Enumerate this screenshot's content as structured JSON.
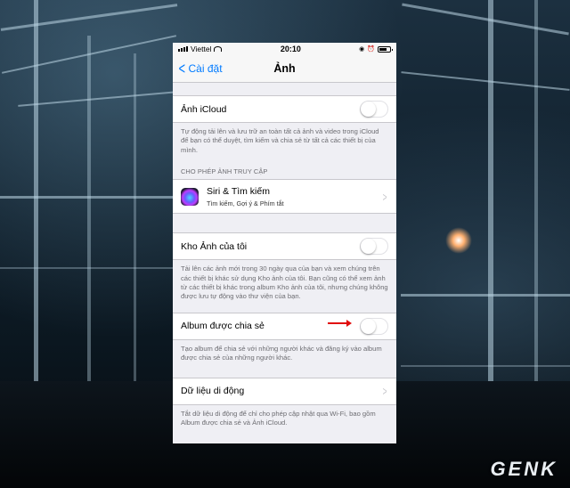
{
  "status": {
    "carrier": "Viettel",
    "time": "20:10"
  },
  "nav": {
    "back_label": "Cài đặt",
    "title": "Ảnh"
  },
  "icloud": {
    "label": "Ảnh iCloud",
    "enabled": false,
    "footer": "Tự động tải lên và lưu trữ an toàn tất cả ảnh và video trong iCloud để bạn có thể duyệt, tìm kiếm và chia sẻ từ tất cả các thiết bị của mình."
  },
  "access": {
    "header": "CHO PHÉP ẢNH TRUY CẬP",
    "siri_title": "Siri & Tìm kiếm",
    "siri_subtitle": "Tìm kiếm, Gợi ý & Phím tắt"
  },
  "my_photo_stream": {
    "label": "Kho Ảnh của tôi",
    "enabled": false,
    "footer": "Tải lên các ảnh mới trong 30 ngày qua của bạn và xem chúng trên các thiết bị khác sử dụng Kho ảnh của tôi. Bạn cũng có thể xem ảnh từ các thiết bị khác trong album Kho ảnh của tôi, nhưng chúng không được lưu tự động vào thư viện của bạn."
  },
  "shared_albums": {
    "label": "Album được chia sẻ",
    "enabled": false,
    "footer": "Tạo album để chia sẻ với những người khác và đăng ký vào album được chia sẻ của những người khác."
  },
  "cellular": {
    "label": "Dữ liệu di động",
    "footer": "Tắt dữ liệu di động để chỉ cho phép cập nhật qua Wi-Fi, bao gồm Album được chia sẻ và Ảnh iCloud."
  },
  "watermark": "GENK"
}
